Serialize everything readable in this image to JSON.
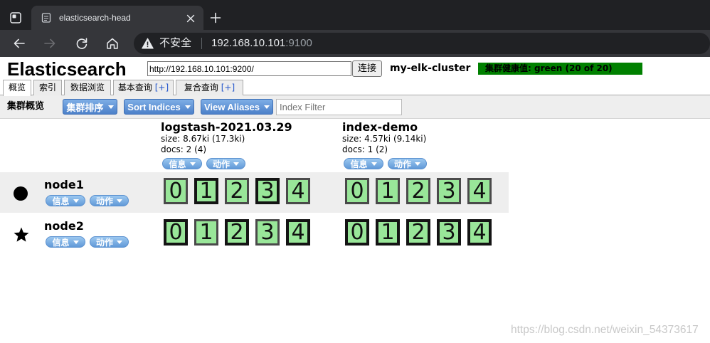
{
  "browser": {
    "tab_title": "elasticsearch-head",
    "security_label": "不安全",
    "url_host": "192.168.10.101",
    "url_port": ":9100"
  },
  "header": {
    "app_title": "Elasticsearch",
    "connect_url": "http://192.168.10.101:9200/",
    "connect_button": "连接",
    "cluster_name": "my-elk-cluster",
    "cluster_health": "集群健康值: green (20 of 20)"
  },
  "tabs": [
    {
      "label": "概览",
      "active": true
    },
    {
      "label": "索引",
      "active": false
    },
    {
      "label": "数据浏览",
      "active": false
    },
    {
      "label": "基本查询",
      "plus": "[+]",
      "active": false
    },
    {
      "label": "复合查询",
      "plus": "[+]",
      "active": false
    }
  ],
  "toolbar": {
    "title": "集群概览",
    "sort_cluster": "集群排序",
    "sort_indices": "Sort Indices",
    "view_aliases": "View Aliases",
    "filter_placeholder": "Index Filter"
  },
  "indices": [
    {
      "name": "logstash-2021.03.29",
      "size": "size: 8.67ki (17.3ki)",
      "docs": "docs: 2 (4)",
      "info_button": "信息",
      "action_button": "动作"
    },
    {
      "name": "index-demo",
      "size": "size: 4.57ki (9.14ki)",
      "docs": "docs: 1 (2)",
      "info_button": "信息",
      "action_button": "动作"
    }
  ],
  "nodes": [
    {
      "name": "node1",
      "icon": "circle-icon",
      "info_button": "信息",
      "action_button": "动作",
      "shards": [
        {
          "ids": [
            "0",
            "1",
            "2",
            "3",
            "4"
          ],
          "primary": [
            false,
            true,
            false,
            true,
            false
          ]
        },
        {
          "ids": [
            "0",
            "1",
            "2",
            "3",
            "4"
          ],
          "primary": [
            false,
            false,
            false,
            false,
            false
          ]
        }
      ]
    },
    {
      "name": "node2",
      "icon": "star-icon",
      "info_button": "信息",
      "action_button": "动作",
      "shards": [
        {
          "ids": [
            "0",
            "1",
            "2",
            "3",
            "4"
          ],
          "primary": [
            true,
            false,
            true,
            false,
            true
          ]
        },
        {
          "ids": [
            "0",
            "1",
            "2",
            "3",
            "4"
          ],
          "primary": [
            true,
            true,
            true,
            true,
            true
          ]
        }
      ]
    }
  ],
  "watermark": "https://blog.csdn.net/weixin_54373617",
  "colors": {
    "health_badge": "#008000",
    "shard_fill": "#99e699",
    "button_blue": "#5a8fd6",
    "link_blue": "#2255cc"
  }
}
